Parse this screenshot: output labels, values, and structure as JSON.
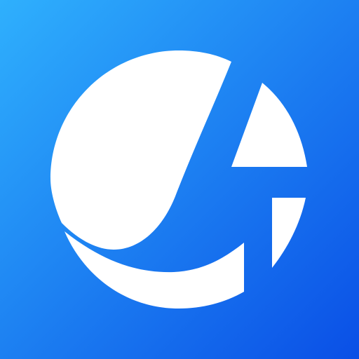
{
  "app_icon": {
    "icon": "circle-swoosh-logo-icon",
    "colors": {
      "background_gradient_start": "#2fb0fd",
      "background_gradient_end": "#0a4fe6",
      "mark": "#ffffff"
    }
  }
}
